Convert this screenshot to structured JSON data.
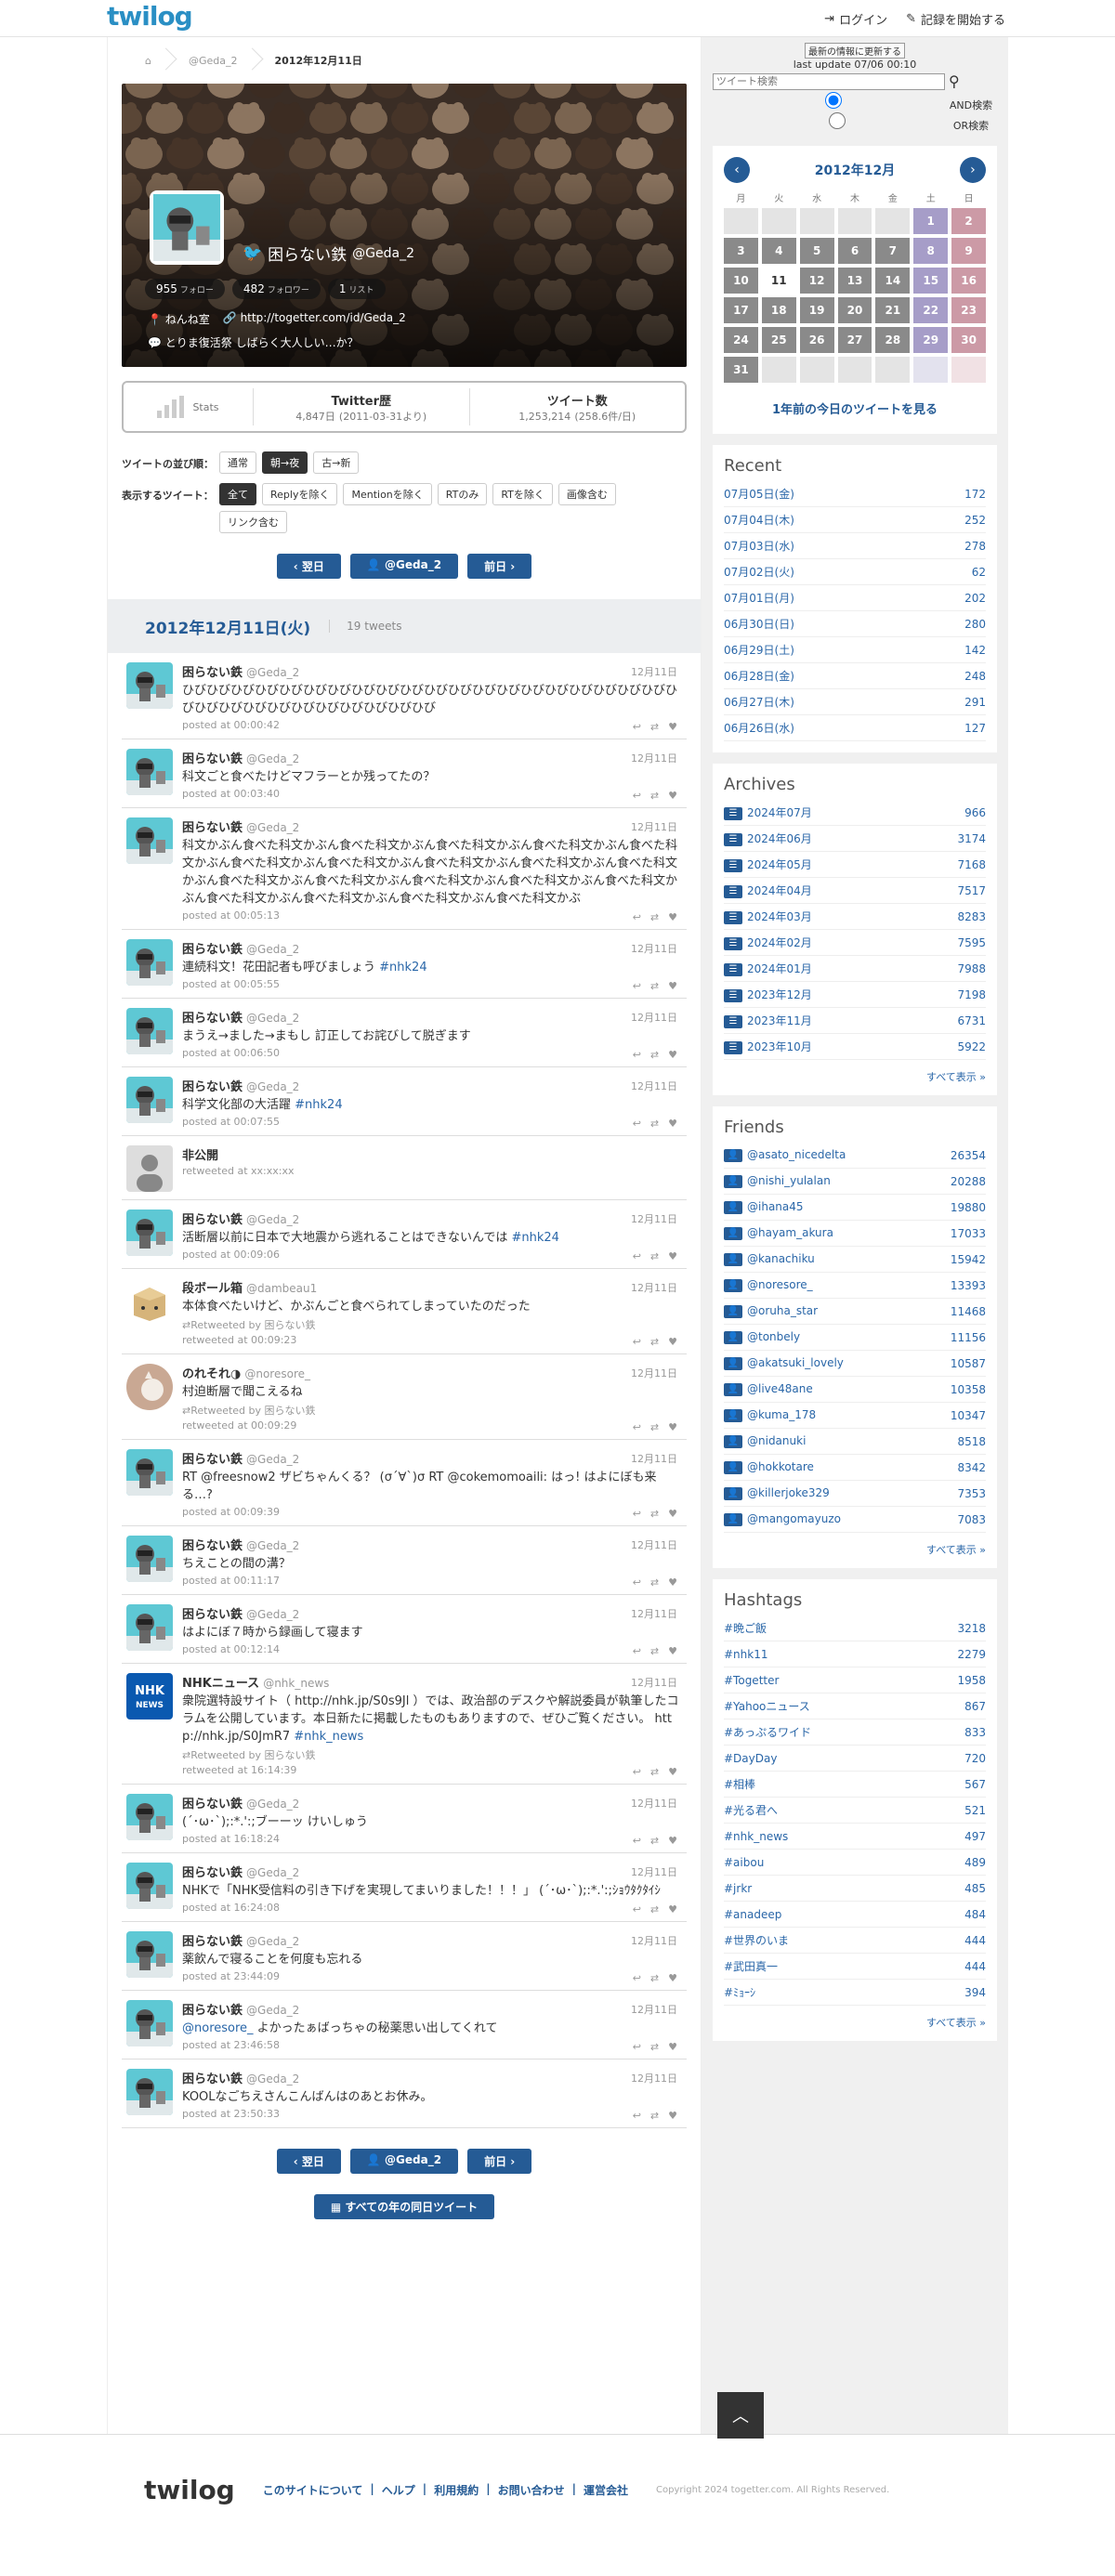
{
  "header": {
    "logo": "twilog",
    "login": "ログイン",
    "start": "記録を開始する"
  },
  "breadcrumb": {
    "user": "@Geda_2",
    "current": "2012年12月11日"
  },
  "profile": {
    "name": "困らない鉄",
    "screen": "@Geda_2",
    "followers": "955",
    "followers_label": "フォロー",
    "following": "482",
    "following_label": "フォロワー",
    "lists": "1",
    "lists_label": "リスト",
    "location": "ねんね室",
    "url": "http://togetter.com/id/Geda_2",
    "bio": "とりま復活祭 しばらく大人しい…か？"
  },
  "stats": {
    "label": "Stats",
    "history_title": "Twitter歴",
    "history_value": "4,847日",
    "history_sub": "(2011-03-31より)",
    "count_title": "ツイート数",
    "count_value": "1,253,214",
    "count_sub": "(258.6件/日)"
  },
  "options": {
    "order_label": "ツイートの並び順：",
    "order": [
      "通常",
      "朝→夜",
      "古→新"
    ],
    "show_label": "表示するツイート：",
    "show": [
      "全て",
      "Replyを除く",
      "Mentionを除く",
      "RTのみ",
      "RTを除く",
      "画像含む",
      "リンク含む"
    ]
  },
  "pager": {
    "next": "翌日",
    "user": "@Geda_2",
    "prev": "前日"
  },
  "day": {
    "date": "2012年12月11日(火)",
    "count": "19 tweets"
  },
  "tweets": [
    {
      "av": "geda",
      "name": "困らない鉄",
      "sn": "@Geda_2",
      "date": "12月11日",
      "text": "ひびひびひびひびひびひびひびひびひびひびひびひびひびひびひびひびひびひびひびひびひびひびひびひびひびひびひびひびひびひびひび",
      "meta": "posted at 00:00:42"
    },
    {
      "av": "geda",
      "name": "困らない鉄",
      "sn": "@Geda_2",
      "date": "12月11日",
      "text": "科文ごと食べたけどマフラーとか残ってたの？",
      "meta": "posted at 00:03:40"
    },
    {
      "av": "geda",
      "name": "困らない鉄",
      "sn": "@Geda_2",
      "date": "12月11日",
      "text": "科文かぶん食べた科文かぶん食べた科文かぶん食べた科文かぶん食べた科文かぶん食べた科文かぶん食べた科文かぶん食べた科文かぶん食べた科文かぶん食べた科文かぶん食べた科文かぶん食べた科文かぶん食べた科文かぶん食べた科文かぶん食べた科文かぶん食べた科文かぶん食べた科文かぶん食べた科文かぶん食べた科文かぶん食べた科文かぶ",
      "meta": "posted at 00:05:13"
    },
    {
      "av": "geda",
      "name": "困らない鉄",
      "sn": "@Geda_2",
      "date": "12月11日",
      "text": "連続科文！花田記者も呼びましょう",
      "tag": "#nhk24",
      "meta": "posted at 00:05:55"
    },
    {
      "av": "geda",
      "name": "困らない鉄",
      "sn": "@Geda_2",
      "date": "12月11日",
      "text": "まうえ→ました→まもし 訂正してお詫びして脱ぎます",
      "meta": "posted at 00:06:50"
    },
    {
      "av": "geda",
      "name": "困らない鉄",
      "sn": "@Geda_2",
      "date": "12月11日",
      "text": "科学文化部の大活躍",
      "tag": "#nhk24",
      "meta": "posted at 00:07:55"
    },
    {
      "av": "anon",
      "name": "非公開",
      "sn": "",
      "date": "",
      "text": "",
      "meta": "retweeted at xx:xx:xx",
      "noacts": true
    },
    {
      "av": "geda",
      "name": "困らない鉄",
      "sn": "@Geda_2",
      "date": "12月11日",
      "text": "活断層以前に日本で大地震から逃れることはできないんでは",
      "tag": "#nhk24",
      "meta": "posted at 00:09:06"
    },
    {
      "av": "box",
      "name": "段ボール箱",
      "sn": "@dambeau1",
      "date": "12月11日",
      "text": "本体食べたいけど、かぶんごと食べられてしまっていたのだった",
      "rt": "Retweeted by 困らない鉄",
      "meta": "retweeted at 00:09:23"
    },
    {
      "av": "cat",
      "name": "のれそれ◑",
      "sn": "@noresore_",
      "date": "12月11日",
      "text": "村迫断層で聞こえるね",
      "rt": "Retweeted by 困らない鉄",
      "meta": "retweeted at 00:09:29"
    },
    {
      "av": "geda",
      "name": "困らない鉄",
      "sn": "@Geda_2",
      "date": "12月11日",
      "text": "RT @freesnow2 ザビちゃんくる？ (σ´∀`)σ RT @cokemomoaili: はっ! はよにぼも来る…?",
      "meta": "posted at 00:09:39"
    },
    {
      "av": "geda",
      "name": "困らない鉄",
      "sn": "@Geda_2",
      "date": "12月11日",
      "text": "ちえことの間の溝？",
      "meta": "posted at 00:11:17"
    },
    {
      "av": "geda",
      "name": "困らない鉄",
      "sn": "@Geda_2",
      "date": "12月11日",
      "text": "はよにぼ７時から録画して寝ます",
      "meta": "posted at 00:12:14"
    },
    {
      "av": "nhk",
      "name": "NHKニュース",
      "sn": "@nhk_news",
      "date": "12月11日",
      "text": "衆院選特設サイト（ http://nhk.jp/S0s9Jl ）では、政治部のデスクや解説委員が執筆したコラムを公開しています。本日新たに掲載したものもありますので、ぜひご覧ください。 http://nhk.jp/S0JmR7",
      "tag": "#nhk_news",
      "rt": "Retweeted by 困らない鉄",
      "meta": "retweeted at 16:14:39"
    },
    {
      "av": "geda",
      "name": "困らない鉄",
      "sn": "@Geda_2",
      "date": "12月11日",
      "text": "(´･ω･`);:*.':;ブーーッ けいしゅう",
      "meta": "posted at 16:18:24"
    },
    {
      "av": "geda",
      "name": "困らない鉄",
      "sn": "@Geda_2",
      "date": "12月11日",
      "text": "NHKで「NHK受信料の引き下げを実現してまいりました！！！」 (´･ω･`);:*.':;ｼｮｳﾀｸﾀｲｼ",
      "meta": "posted at 16:24:08"
    },
    {
      "av": "geda",
      "name": "困らない鉄",
      "sn": "@Geda_2",
      "date": "12月11日",
      "text": "薬飲んで寝ることを何度も忘れる",
      "meta": "posted at 23:44:09"
    },
    {
      "av": "geda",
      "name": "困らない鉄",
      "sn": "@Geda_2",
      "date": "12月11日",
      "link": "@noresore_",
      "text": " よかったぁばっちゃの秘薬思い出してくれて",
      "meta": "posted at 23:46:58"
    },
    {
      "av": "geda",
      "name": "困らない鉄",
      "sn": "@Geda_2",
      "date": "12月11日",
      "text": "KOOLなごちえさんこんばんはのあとお休み。",
      "meta": "posted at 23:50:33"
    }
  ],
  "all_years": "すべての年の同日ツイート",
  "search": {
    "update": "最新の情報に更新する",
    "last_update": "last update 07/06 00:10",
    "placeholder": "ツイート検索",
    "and": "AND検索",
    "or": "OR検索"
  },
  "calendar": {
    "month": "2012年12月",
    "weekdays": [
      "月",
      "火",
      "水",
      "木",
      "金",
      "土",
      "日"
    ],
    "link": "1年前の今日のツイートを見る"
  },
  "recent": {
    "title": "Recent",
    "items": [
      [
        "07月05日(金)",
        "172"
      ],
      [
        "07月04日(木)",
        "252"
      ],
      [
        "07月03日(水)",
        "278"
      ],
      [
        "07月02日(火)",
        "62"
      ],
      [
        "07月01日(月)",
        "202"
      ],
      [
        "06月30日(日)",
        "280"
      ],
      [
        "06月29日(土)",
        "142"
      ],
      [
        "06月28日(金)",
        "248"
      ],
      [
        "06月27日(木)",
        "291"
      ],
      [
        "06月26日(水)",
        "127"
      ]
    ]
  },
  "archives": {
    "title": "Archives",
    "items": [
      [
        "2024年07月",
        "966"
      ],
      [
        "2024年06月",
        "3174"
      ],
      [
        "2024年05月",
        "7168"
      ],
      [
        "2024年04月",
        "7517"
      ],
      [
        "2024年03月",
        "8283"
      ],
      [
        "2024年02月",
        "7595"
      ],
      [
        "2024年01月",
        "7988"
      ],
      [
        "2023年12月",
        "7198"
      ],
      [
        "2023年11月",
        "6731"
      ],
      [
        "2023年10月",
        "5922"
      ]
    ],
    "more": "すべて表示 »"
  },
  "friends": {
    "title": "Friends",
    "items": [
      [
        "@asato_nicedelta",
        "26354"
      ],
      [
        "@nishi_yulalan",
        "20288"
      ],
      [
        "@ihana45",
        "19880"
      ],
      [
        "@hayam_akura",
        "17033"
      ],
      [
        "@kanachiku",
        "15942"
      ],
      [
        "@noresore_",
        "13393"
      ],
      [
        "@oruha_star",
        "11468"
      ],
      [
        "@tonbely",
        "11156"
      ],
      [
        "@akatsuki_lovely",
        "10587"
      ],
      [
        "@live48ane",
        "10358"
      ],
      [
        "@kuma_178",
        "10347"
      ],
      [
        "@nidanuki",
        "8518"
      ],
      [
        "@hokkotare",
        "8342"
      ],
      [
        "@killerjoke329",
        "7353"
      ],
      [
        "@mangomayuzo",
        "7083"
      ]
    ],
    "more": "すべて表示 »"
  },
  "hashtags": {
    "title": "Hashtags",
    "items": [
      [
        "#晩ご飯",
        "3218"
      ],
      [
        "#nhk11",
        "2279"
      ],
      [
        "#Togetter",
        "1958"
      ],
      [
        "#Yahooニュース",
        "867"
      ],
      [
        "#あっぷるワイド",
        "833"
      ],
      [
        "#DayDay",
        "720"
      ],
      [
        "#相棒",
        "567"
      ],
      [
        "#光る君へ",
        "521"
      ],
      [
        "#nhk_news",
        "497"
      ],
      [
        "#aibou",
        "489"
      ],
      [
        "#jrkr",
        "485"
      ],
      [
        "#anadeep",
        "484"
      ],
      [
        "#世界のいま",
        "444"
      ],
      [
        "#武田真一",
        "444"
      ],
      [
        "#ﾐｮｰｼ",
        "394"
      ]
    ],
    "more": "すべて表示 »"
  },
  "footer": {
    "logo": "twilog",
    "links": [
      "このサイトについて",
      "ヘルプ",
      "利用規約",
      "お問い合わせ",
      "運営会社"
    ],
    "copy": "Copyright 2024 togetter.com. All Rights Reserved."
  }
}
